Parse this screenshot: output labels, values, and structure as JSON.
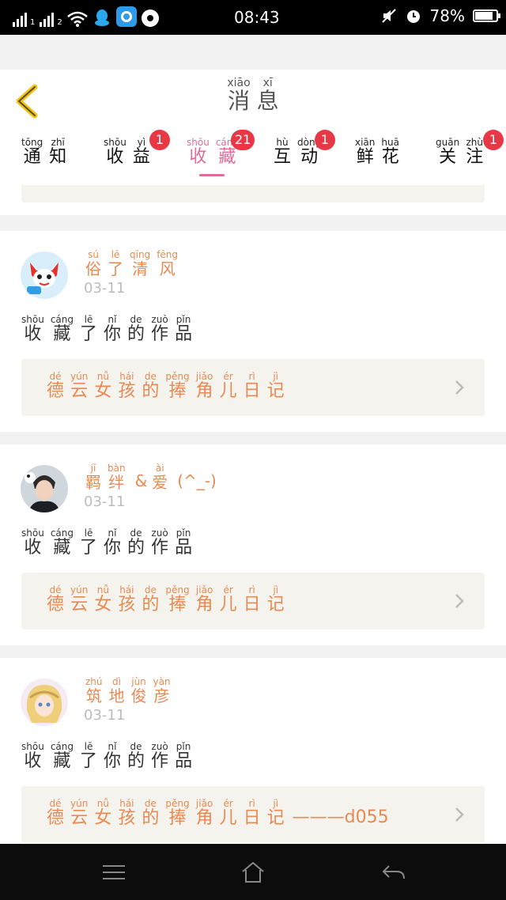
{
  "status_bar": {
    "sim1": "1",
    "sim2": "2",
    "time": "08:43",
    "battery": "78%",
    "battery_level": 0.78
  },
  "header": {
    "title": [
      {
        "py": "xiāo",
        "hz": "消"
      },
      {
        "py": "xī",
        "hz": "息"
      }
    ]
  },
  "tabs": [
    {
      "chars": [
        {
          "py": "tōng",
          "hz": "通"
        },
        {
          "py": "zhī",
          "hz": "知"
        }
      ],
      "badge": null
    },
    {
      "chars": [
        {
          "py": "shōu",
          "hz": "收"
        },
        {
          "py": "yì",
          "hz": "益"
        }
      ],
      "badge": "1"
    },
    {
      "chars": [
        {
          "py": "shōu",
          "hz": "收"
        },
        {
          "py": "cáng",
          "hz": "藏"
        }
      ],
      "badge": "21",
      "active": true
    },
    {
      "chars": [
        {
          "py": "hù",
          "hz": "互"
        },
        {
          "py": "dòng",
          "hz": "动"
        }
      ],
      "badge": "1"
    },
    {
      "chars": [
        {
          "py": "xiān",
          "hz": "鲜"
        },
        {
          "py": "huā",
          "hz": "花"
        }
      ],
      "badge": null
    },
    {
      "chars": [
        {
          "py": "guān",
          "hz": "关"
        },
        {
          "py": "zhù",
          "hz": "注"
        }
      ],
      "badge": "1"
    }
  ],
  "action_text": [
    {
      "py": "shōu",
      "hz": "收"
    },
    {
      "py": "cáng",
      "hz": "藏"
    },
    {
      "py": "lē",
      "hz": "了"
    },
    {
      "py": "nǐ",
      "hz": "你"
    },
    {
      "py": "de",
      "hz": "的"
    },
    {
      "py": "zuò",
      "hz": "作"
    },
    {
      "py": "pǐn",
      "hz": "品"
    }
  ],
  "work_title": [
    {
      "py": "dé",
      "hz": "德"
    },
    {
      "py": "yún",
      "hz": "云"
    },
    {
      "py": "nǚ",
      "hz": "女"
    },
    {
      "py": "hái",
      "hz": "孩"
    },
    {
      "py": "de",
      "hz": "的"
    },
    {
      "py": "pěng",
      "hz": "捧"
    },
    {
      "py": "jiǎo",
      "hz": "角"
    },
    {
      "py": "ér",
      "hz": "儿"
    },
    {
      "py": "rì",
      "hz": "日"
    },
    {
      "py": "jì",
      "hz": "记"
    }
  ],
  "items": [
    {
      "user": [
        {
          "py": "sú",
          "hz": "俗"
        },
        {
          "py": "lē",
          "hz": "了"
        },
        {
          "py": "qīng",
          "hz": "清"
        },
        {
          "py": "fēng",
          "hz": "风"
        }
      ],
      "user_suffix": "",
      "date": "03-11",
      "work_suffix": "",
      "avatar": "red-fox-avatar"
    },
    {
      "user": [
        {
          "py": "jī",
          "hz": "羁"
        },
        {
          "py": "bàn",
          "hz": "绊"
        }
      ],
      "user_suffix": "&",
      "user2": [
        {
          "py": "ài",
          "hz": "爱"
        }
      ],
      "user_tail": "(^_-)",
      "date": "03-11",
      "work_suffix": "",
      "avatar": "boy-avatar"
    },
    {
      "user": [
        {
          "py": "zhú",
          "hz": "筑"
        },
        {
          "py": "dì",
          "hz": "地"
        },
        {
          "py": "jùn",
          "hz": "俊"
        },
        {
          "py": "yàn",
          "hz": "彦"
        }
      ],
      "user_suffix": "",
      "date": "03-11",
      "work_suffix": "———d055",
      "avatar": "anime-girl-avatar"
    }
  ]
}
